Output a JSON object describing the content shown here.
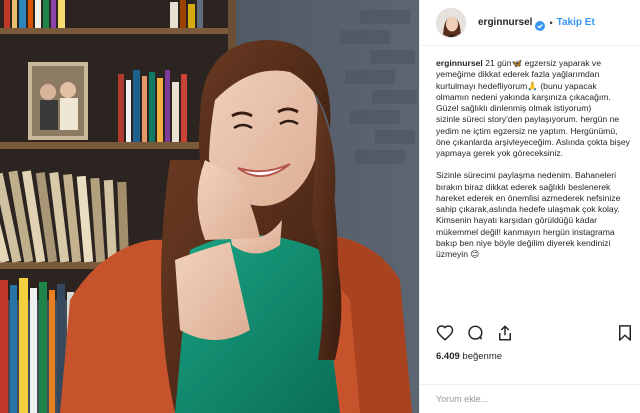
{
  "post": {
    "username": "erginnursel",
    "follow_label": "Takip Et",
    "separator": "•",
    "caption_lines": [
      "21 gün🦋 egzersiz yaparak ve yemeğime dikkat ederek fazla yağlarımdan kurtulmayı hedefliyorum🙏 (bunu yapacak olmamın nedeni yakında karşınıza çıkacağım. Güzel sağlıklı dinlenmiş olmak istiyorum)",
      "sizinle süreci story'den paylaşıyorum. hergün ne yedim ne içtim egzersiz ne yaptım. Hergünümü, öne çıkanlarda arşivleyeceğim. Aslında çokta bişey yapmaya gerek yok göreceksiniz.",
      "",
      "Sizinle sürecimi paylaşma nedenim. Bahaneleri bırakın biraz dikkat ederek sağlıklı beslenerek hareket ederek en önemlisi azmederek nefsinize sahip çıkarak,aslında hedefe ulaşmak çok kolay. Kimsenin hayatı karşıdan görüldüğü kadar mükemmel değil! kanmayın hergün instagrama bakıp ben niye böyle değilim diyerek kendinizi üzmeyin 😊"
    ],
    "likes_count": "6.409",
    "likes_label": "beğenme",
    "comment_placeholder": "Yorum ekle..."
  },
  "icons": {
    "like": "heart-icon",
    "comment": "comment-icon",
    "share": "share-icon",
    "save": "bookmark-icon",
    "verified": "verified-badge-icon"
  },
  "colors": {
    "accent": "#3897f0",
    "text": "#262626",
    "muted": "#999999",
    "divider": "#efefef"
  }
}
